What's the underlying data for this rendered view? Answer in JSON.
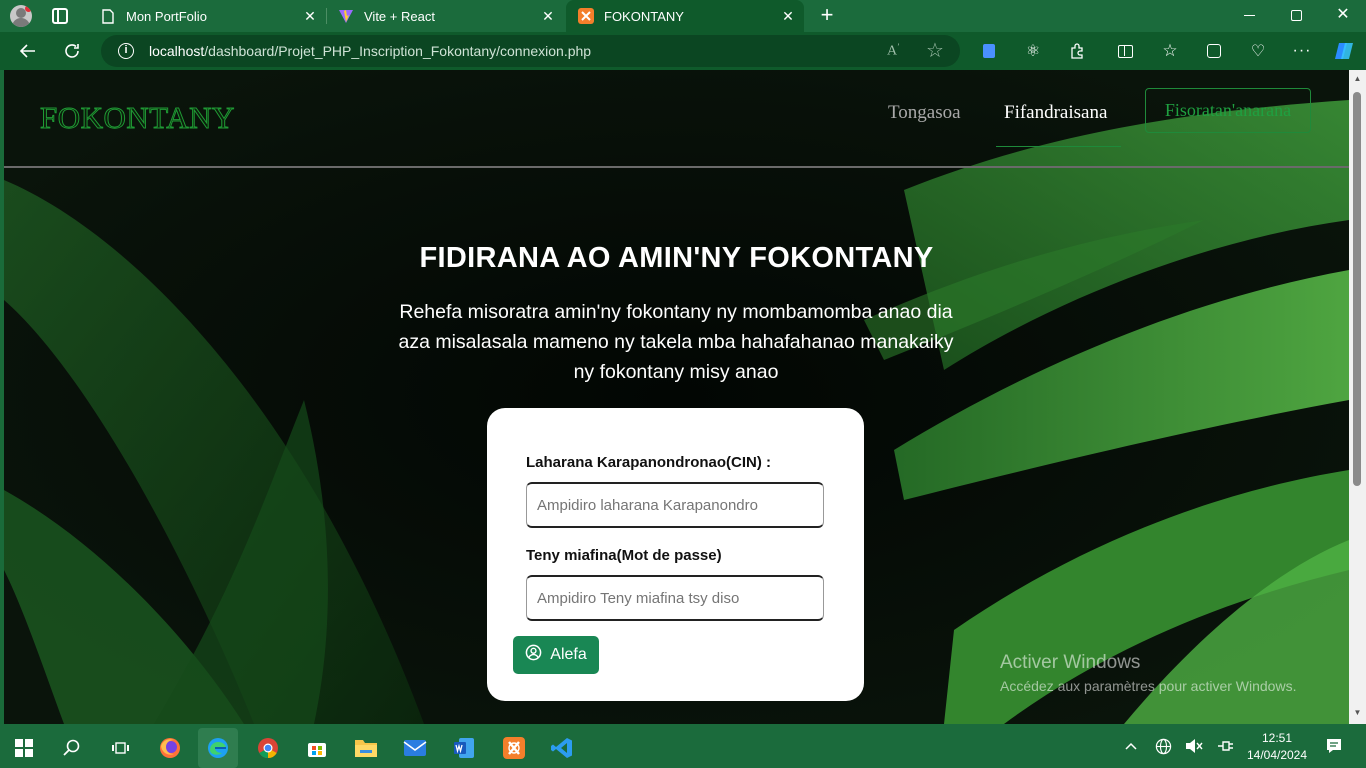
{
  "browser": {
    "tabs": [
      {
        "title": "Mon PortFolio",
        "icon": "page-icon"
      },
      {
        "title": "Vite + React",
        "icon": "vite-icon"
      },
      {
        "title": "FOKONTANY",
        "icon": "xampp-icon",
        "active": true
      }
    ],
    "url": {
      "host": "localhost",
      "path": "/dashboard/Projet_PHP_Inscription_Fokontany/connexion.php"
    }
  },
  "navbar": {
    "brand": "FOKONTANY",
    "links": {
      "home": "Tongasoa",
      "login": "Fifandraisana",
      "register": "Fisoratan'anarana"
    }
  },
  "hero": {
    "title": "FIDIRANA AO AMIN'NY FOKONTANY",
    "subtitle": "Rehefa misoratra amin'ny fokontany ny mombamomba anao dia aza misalasala mameno ny takela mba hahafahanao manakaiky ny fokontany misy anao"
  },
  "form": {
    "cin_label": "Laharana Karapanondronao(CIN) :",
    "cin_placeholder": "Ampidiro laharana Karapanondro",
    "password_label": "Teny miafina(Mot de passe)",
    "password_placeholder": "Ampidiro Teny miafina tsy diso",
    "submit_label": "Alefa"
  },
  "watermark": {
    "line1": "Activer Windows",
    "line2": "Accédez aux paramètres pour activer Windows."
  },
  "taskbar": {
    "time": "12:51",
    "date": "14/04/2024"
  },
  "colors": {
    "chrome": "#1b6b3c",
    "accent_green": "#198754",
    "brand_green": "#1f9a34"
  }
}
